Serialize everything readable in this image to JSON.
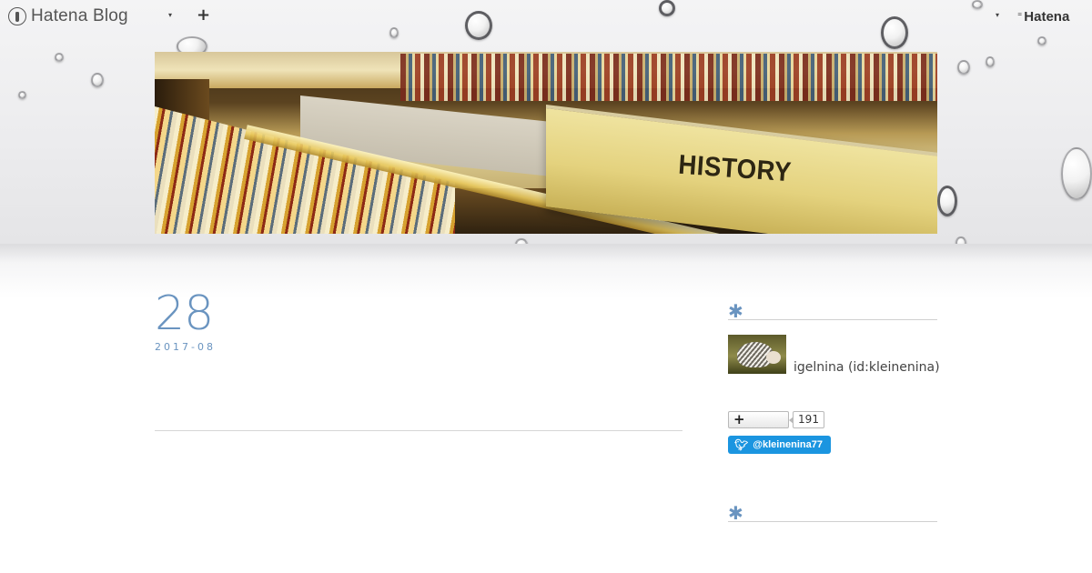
{
  "global_header": {
    "brand": "Hatena Blog",
    "brand_dropdown_icon": "▾",
    "add_icon": "+",
    "menu_dropdown_icon": "▾",
    "hatena_label": "Hatena"
  },
  "header_image": {
    "sign_text": "HISTORY"
  },
  "entry": {
    "day": "28",
    "year_month": "2017-08"
  },
  "sidebar": {
    "profile_module": {
      "title_mark": "✱",
      "display_name": "igelnina (id:kleinenina)"
    },
    "bookmark": {
      "icon": "+",
      "count": "191"
    },
    "twitter_follow": {
      "label": "@kleinenina77"
    },
    "second_module": {
      "title_mark": "✱"
    }
  },
  "colors": {
    "accent": "#6a94c0",
    "twitter": "#1b95e0",
    "divider": "#d6d6d6"
  }
}
